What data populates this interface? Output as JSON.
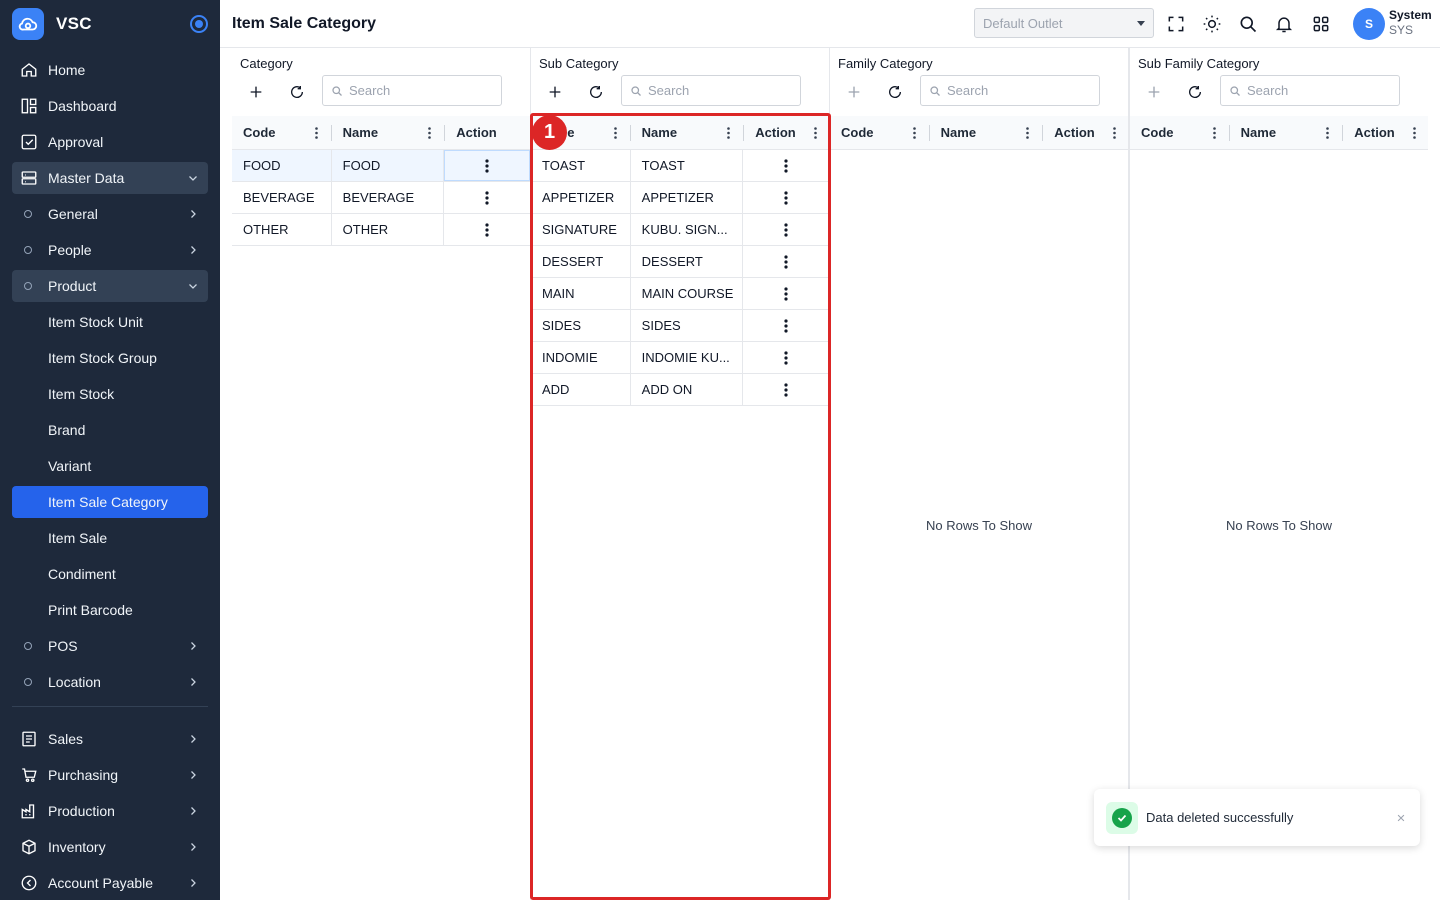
{
  "app": {
    "name": "VSC"
  },
  "header": {
    "title": "Item Sale Category",
    "outlet_placeholder": "Default Outlet",
    "user": {
      "initial": "S",
      "name": "System",
      "code": "SYS"
    }
  },
  "sidebar": {
    "items": [
      {
        "label": "Home",
        "icon": "home-icon"
      },
      {
        "label": "Dashboard",
        "icon": "dashboard-icon"
      },
      {
        "label": "Approval",
        "icon": "approval-icon"
      },
      {
        "label": "Master Data",
        "icon": "database-icon"
      },
      {
        "label": "General"
      },
      {
        "label": "People"
      },
      {
        "label": "Product"
      },
      {
        "label": "Item Stock Unit"
      },
      {
        "label": "Item Stock Group"
      },
      {
        "label": "Item Stock"
      },
      {
        "label": "Brand"
      },
      {
        "label": "Variant"
      },
      {
        "label": "Item Sale Category"
      },
      {
        "label": "Item Sale"
      },
      {
        "label": "Condiment"
      },
      {
        "label": "Print Barcode"
      },
      {
        "label": "POS"
      },
      {
        "label": "Location"
      },
      {
        "label": "Sales",
        "icon": "sales-icon"
      },
      {
        "label": "Purchasing",
        "icon": "cart-icon"
      },
      {
        "label": "Production",
        "icon": "factory-icon"
      },
      {
        "label": "Inventory",
        "icon": "box-icon"
      },
      {
        "label": "Account Payable",
        "icon": "payable-icon"
      }
    ]
  },
  "columns": {
    "code": "Code",
    "name": "Name",
    "action": "Action"
  },
  "search_placeholder": "Search",
  "empty_text": "No Rows To Show",
  "panels": {
    "category": {
      "title": "Category",
      "rows": [
        {
          "code": "FOOD",
          "name": "FOOD"
        },
        {
          "code": "BEVERAGE",
          "name": "BEVERAGE"
        },
        {
          "code": "OTHER",
          "name": "OTHER"
        }
      ]
    },
    "sub_category": {
      "title": "Sub Category",
      "rows": [
        {
          "code": "TOAST",
          "name": "TOAST"
        },
        {
          "code": "APPETIZER",
          "name": "APPETIZER"
        },
        {
          "code": "SIGNATURE",
          "name": "KUBU. SIGN..."
        },
        {
          "code": "DESSERT",
          "name": "DESSERT"
        },
        {
          "code": "MAIN",
          "name": "MAIN COURSE"
        },
        {
          "code": "SIDES",
          "name": "SIDES"
        },
        {
          "code": "INDOMIE",
          "name": "INDOMIE KU..."
        },
        {
          "code": "ADD",
          "name": "ADD ON"
        }
      ]
    },
    "family_category": {
      "title": "Family Category"
    },
    "sub_family_category": {
      "title": "Sub Family Category"
    }
  },
  "annotation": {
    "number": "1"
  },
  "toast": {
    "message": "Data deleted successfully"
  },
  "colors": {
    "sidebar": "#1e293b",
    "accent": "#2563eb",
    "highlight": "#dc2626",
    "success": "#16a34a"
  }
}
